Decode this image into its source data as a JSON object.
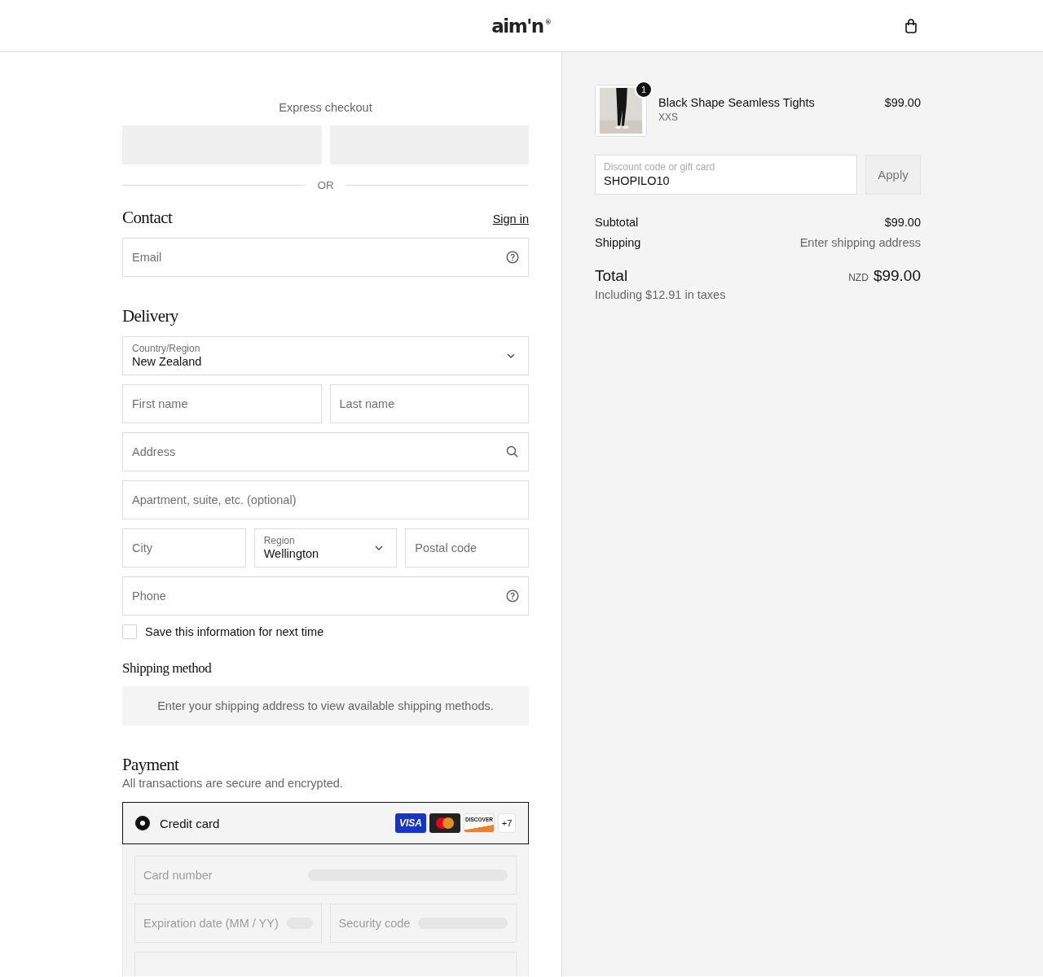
{
  "header": {
    "logo": "aim'n",
    "logo_mark": "®"
  },
  "express_checkout": {
    "title": "Express checkout",
    "divider": "OR"
  },
  "contact": {
    "heading": "Contact",
    "sign_in": "Sign in",
    "email": {
      "placeholder": "Email",
      "kind": "help"
    }
  },
  "delivery": {
    "heading": "Delivery",
    "rows": [
      {
        "fields": [
          {
            "kind": "select",
            "label": "Country/Region",
            "value": "New Zealand"
          }
        ]
      },
      {
        "fields": [
          {
            "kind": "text",
            "placeholder": "First name"
          },
          {
            "kind": "text",
            "placeholder": "Last name"
          }
        ]
      },
      {
        "fields": [
          {
            "kind": "search",
            "placeholder": "Address"
          }
        ]
      },
      {
        "fields": [
          {
            "kind": "text",
            "placeholder": "Apartment, suite, etc. (optional)"
          }
        ]
      },
      {
        "fields": [
          {
            "kind": "text",
            "placeholder": "City"
          },
          {
            "kind": "select",
            "label": "Region",
            "value": "Wellington"
          },
          {
            "kind": "text",
            "placeholder": "Postal code"
          }
        ]
      },
      {
        "fields": [
          {
            "kind": "help",
            "placeholder": "Phone"
          }
        ]
      }
    ],
    "save_info": {
      "label": "Save this information for next time",
      "checked": false
    }
  },
  "shipping_method": {
    "heading": "Shipping method",
    "message": "Enter your shipping address to view available shipping methods."
  },
  "payment": {
    "heading": "Payment",
    "subtitle": "All transactions are secure and encrypted.",
    "methods": [
      {
        "label": "Credit card",
        "selected": true,
        "brands": [
          {
            "kind": "visa",
            "text": "VISA"
          },
          {
            "kind": "mastercard"
          },
          {
            "kind": "discover",
            "text": "DISCOVER"
          }
        ],
        "more": "+7"
      }
    ],
    "card_rows": [
      {
        "fields": [
          {
            "placeholder": "Card number"
          }
        ]
      },
      {
        "fields": [
          {
            "placeholder": "Expiration date (MM / YY)"
          },
          {
            "placeholder": "Security code"
          }
        ]
      }
    ]
  },
  "summary": {
    "items": [
      {
        "name": "Black Shape Seamless Tights",
        "variant": "XXS",
        "price": "$99.00",
        "quantity": "1"
      }
    ],
    "discount": {
      "label": "Discount code or gift card",
      "value": "SHOPILO10",
      "button": "Apply"
    },
    "lines": [
      {
        "label": "Subtotal",
        "value": "$99.00",
        "muted": false
      },
      {
        "label": "Shipping",
        "value": "Enter shipping address",
        "muted": true
      }
    ],
    "total": {
      "label": "Total",
      "currency": "NZD",
      "amount": "$99.00",
      "tax_note": "Including $12.91 in taxes"
    }
  }
}
